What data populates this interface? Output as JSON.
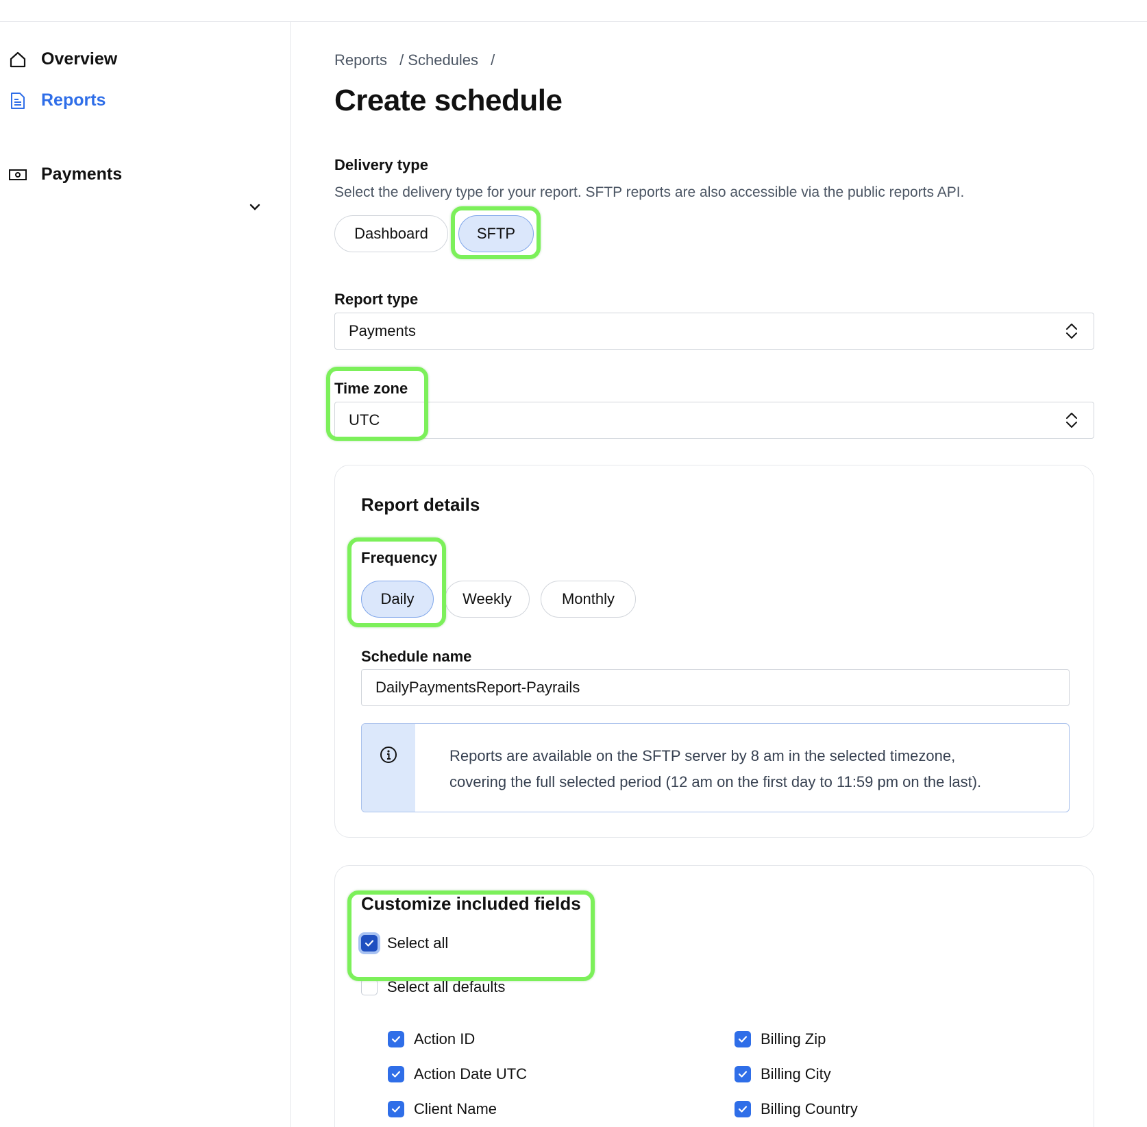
{
  "sidebar": {
    "items": [
      {
        "label": "Overview",
        "icon": "home-icon",
        "active": false
      },
      {
        "label": "Reports",
        "icon": "document-icon",
        "active": true
      },
      {
        "label": "Payments",
        "icon": "banknote-icon",
        "active": false,
        "expandable": true
      }
    ]
  },
  "breadcrumb": {
    "items": [
      "Reports",
      "Schedules"
    ],
    "separator": "/"
  },
  "page": {
    "title": "Create schedule"
  },
  "delivery": {
    "label": "Delivery type",
    "description": "Select the delivery type for your report. SFTP reports are also accessible via the public reports API.",
    "options": [
      "Dashboard",
      "SFTP"
    ],
    "selected": "SFTP"
  },
  "report_type": {
    "label": "Report type",
    "value": "Payments"
  },
  "time_zone": {
    "label": "Time zone",
    "value": "UTC"
  },
  "report_details": {
    "title": "Report details",
    "frequency": {
      "label": "Frequency",
      "options": [
        "Daily",
        "Weekly",
        "Monthly"
      ],
      "selected": "Daily"
    },
    "schedule_name": {
      "label": "Schedule name",
      "value": "DailyPaymentsReport-Payrails"
    },
    "info": {
      "line1": "Reports are available on the SFTP server by 8 am in the selected timezone,",
      "line2": "covering the full selected period (12 am on the first day to 11:59 pm on the last)."
    }
  },
  "fields": {
    "title": "Customize included fields",
    "select_all": {
      "label": "Select all",
      "checked": true
    },
    "select_all_defaults": {
      "label": "Select all defaults",
      "checked": false
    },
    "left_column": [
      {
        "label": "Action ID",
        "checked": true
      },
      {
        "label": "Action Date UTC",
        "checked": true
      },
      {
        "label": "Client Name",
        "checked": true
      }
    ],
    "right_column": [
      {
        "label": "Billing Zip",
        "checked": true
      },
      {
        "label": "Billing City",
        "checked": true
      },
      {
        "label": "Billing Country",
        "checked": true
      }
    ]
  },
  "colors": {
    "accent": "#2f6ee8",
    "selected_pill_bg": "#dbe7fb",
    "highlight": "#7cf05a",
    "info_strip": "#dce8fb"
  }
}
